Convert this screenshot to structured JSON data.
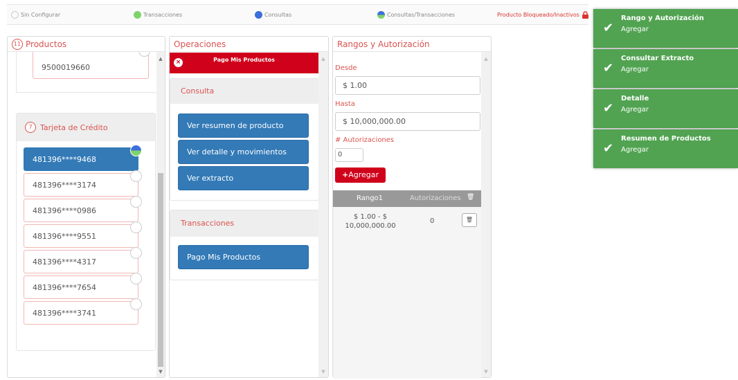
{
  "legend": {
    "sin_configurar": "Sin Configurar",
    "transacciones": "Transacciones",
    "consultas": "Consultas",
    "consultas_transacciones": "Consultas/Transacciones",
    "bloqueado": "Producto Bloqueado/Inactivos",
    "colors": {
      "transacciones": "#7ed36b",
      "consultas": "#3b6fdb",
      "bloqueado": "#d9352f"
    }
  },
  "productos": {
    "count": "11",
    "title": "Productos",
    "account": "9500019660",
    "group": {
      "count": "7",
      "title": "Tarjeta de Crédito"
    },
    "cards": [
      "481396****9468",
      "481396****3174",
      "481396****0986",
      "481396****9551",
      "481396****4317",
      "481396****7654",
      "481396****3741"
    ]
  },
  "operaciones": {
    "title": "Operaciones",
    "banner": "Pago Mis Productos",
    "consulta_title": "Consulta",
    "consulta_buttons": [
      "Ver resumen de producto",
      "Ver detalle y movimientos",
      "Ver extracto"
    ],
    "transacciones_title": "Transacciones",
    "transacciones_buttons": [
      "Pago Mis Productos"
    ]
  },
  "rangos": {
    "title": "Rangos y Autorización",
    "desde_label": "Desde",
    "desde_value": "$ 1.00",
    "hasta_label": "Hasta",
    "hasta_value": "$ 10,000,000.00",
    "autorizaciones_label": "# Autorizaciones",
    "autorizaciones_value": "0",
    "agregar_label": "Agregar",
    "table": {
      "col1": "Rango1",
      "col2": "Autorizaciones",
      "row": {
        "range_line1": "$ 1.00 - $",
        "range_line2": "10,000,000.00",
        "auth": "0"
      }
    }
  },
  "toasts": [
    {
      "title": "Rango y Autorización",
      "message": "Agregar"
    },
    {
      "title": "Consultar Extracto",
      "message": "Agregar"
    },
    {
      "title": "Detalle",
      "message": "Agregar"
    },
    {
      "title": "Resumen de Productos",
      "message": "Agregar"
    }
  ]
}
